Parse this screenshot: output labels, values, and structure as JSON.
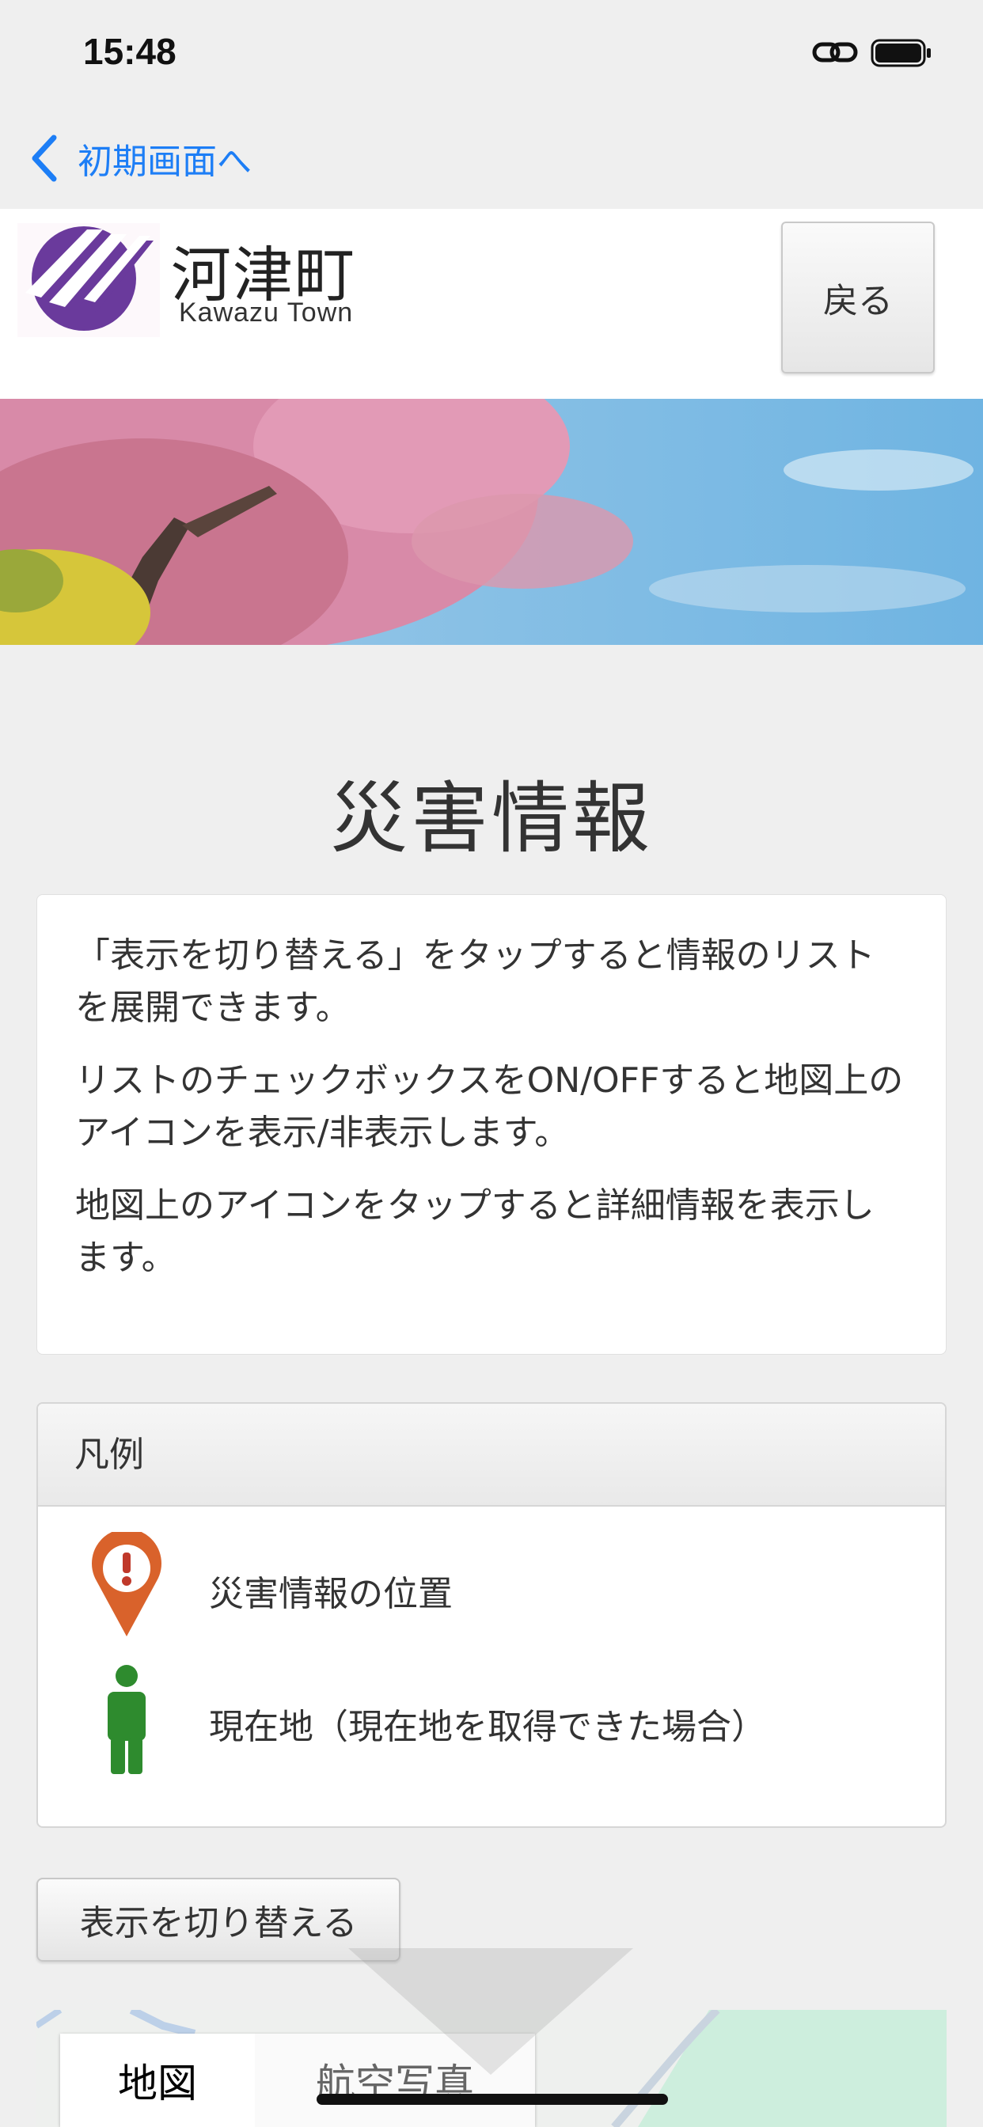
{
  "status_bar": {
    "time": "15:48"
  },
  "nav": {
    "back_label": "初期画面へ"
  },
  "header": {
    "town_name": "河津町",
    "town_name_en": "Kawazu Town",
    "back_button": "戻る"
  },
  "page": {
    "title": "災害情報"
  },
  "info": {
    "paragraphs": [
      "「表示を切り替える」をタップすると情報のリストを展開できます。",
      "リストのチェックボックスをON/OFFすると地図上のアイコンを表示/非表示します。",
      "地図上のアイコンをタップすると詳細情報を表示します。"
    ]
  },
  "legend": {
    "heading": "凡例",
    "items": [
      {
        "icon": "disaster-pin-icon",
        "label": "災害情報の位置",
        "color": "#d9622b"
      },
      {
        "icon": "person-icon",
        "label": "現在地（現在地を取得できた場合）",
        "color": "#2e8b2e"
      }
    ]
  },
  "toggle": {
    "label": "表示を切り替える"
  },
  "map": {
    "tabs": [
      {
        "label": "地図",
        "active": true
      },
      {
        "label": "航空写真",
        "active": false
      }
    ]
  },
  "colors": {
    "accent": "#1d7ef6",
    "logo": "#6a3a9c"
  }
}
